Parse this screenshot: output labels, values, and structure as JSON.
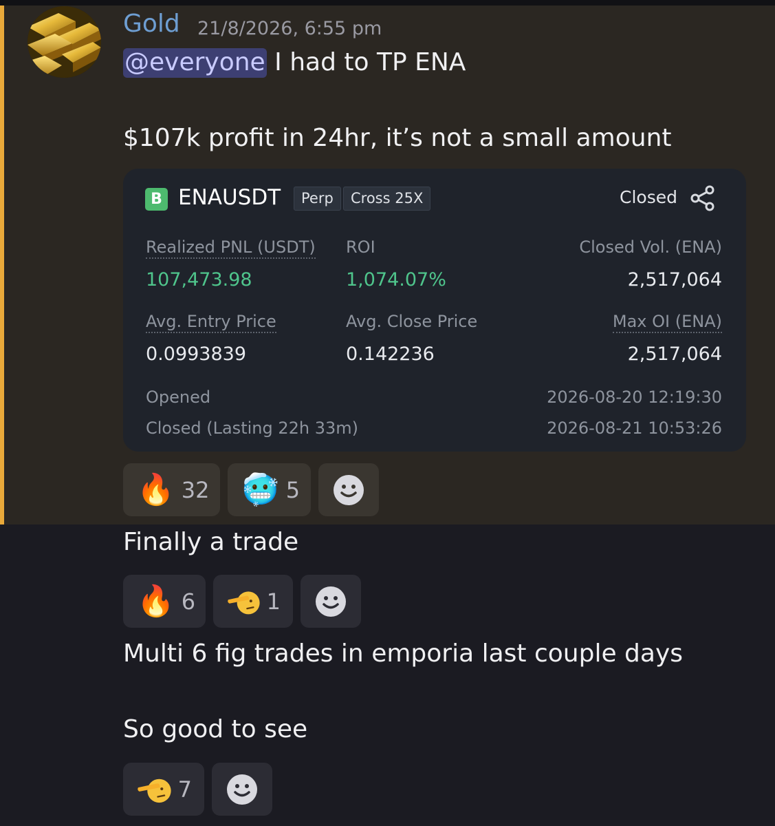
{
  "message": {
    "author": "Gold",
    "timestamp": "21/8/2026, 6:55 pm",
    "mention": "@everyone",
    "text_line1": " I had to TP ENA",
    "text_line2": "$107k profit in 24hr, it’s not a small amount"
  },
  "card": {
    "logo_letter": "B",
    "symbol": "ENAUSDT",
    "tag_type": "Perp",
    "tag_margin": "Cross 25X",
    "status": "Closed",
    "realized_pnl_label": "Realized PNL (USDT)",
    "realized_pnl_value": "107,473.98",
    "roi_label": "ROI",
    "roi_value": "1,074.07%",
    "closed_vol_label": "Closed Vol. (ENA)",
    "closed_vol_value": "2,517,064",
    "avg_entry_label": "Avg. Entry Price",
    "avg_entry_value": "0.0993839",
    "avg_close_label": "Avg. Close Price",
    "avg_close_value": "0.142236",
    "max_oi_label": "Max OI (ENA)",
    "max_oi_value": "2,517,064",
    "opened_label": "Opened",
    "opened_value": "2026-08-20 12:19:30",
    "closed_label": "Closed (Lasting 22h 33m)",
    "closed_value": "2026-08-21 10:53:26",
    "colors": {
      "profit": "#4fc58c",
      "logo": "#4dba6e"
    }
  },
  "reactions1": [
    {
      "emoji": "🔥",
      "count": "32"
    },
    {
      "emoji": "🥶",
      "count": "5"
    }
  ],
  "followups": {
    "line1": "Finally a trade",
    "line2": "Multi 6 fig trades in emporia last couple days",
    "line3": "So good to see"
  },
  "reactions2": [
    {
      "emoji": "🔥",
      "count": "6"
    },
    {
      "emoji": "salute",
      "count": "1"
    }
  ],
  "reactions3": [
    {
      "emoji": "salute",
      "count": "7"
    }
  ],
  "theme": {
    "highlight_bg": "#2b2722",
    "highlight_bar": "#e9a93a",
    "author_color": "#6e9ed2",
    "mention_bg": "#3d3f72"
  }
}
